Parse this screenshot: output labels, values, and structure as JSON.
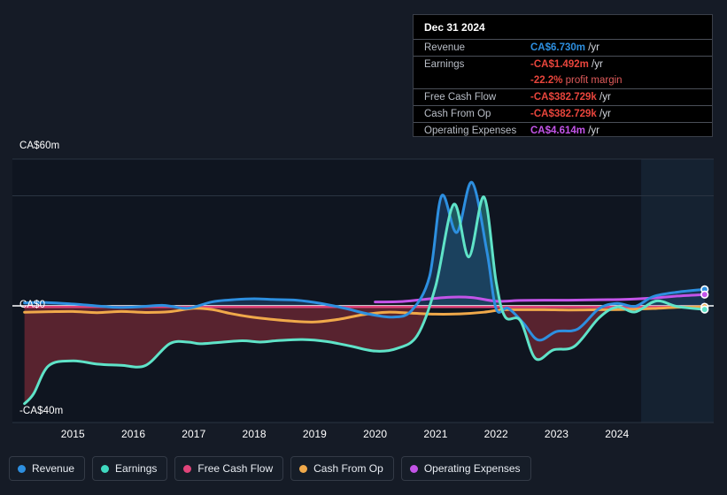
{
  "chart_data": {
    "type": "area",
    "title": "",
    "xlabel": "",
    "ylabel": "",
    "currency": "CA$",
    "xlim": [
      2014.0,
      2025.6
    ],
    "ylim": [
      -40,
      60
    ],
    "yticks": [
      60,
      0,
      -40
    ],
    "ytick_labels": [
      "CA$60m",
      "CA$0",
      "-CA$40m"
    ],
    "gridlines": [
      60,
      45
    ],
    "categories": [
      "2015",
      "2016",
      "2017",
      "2018",
      "2019",
      "2020",
      "2021",
      "2022",
      "2023",
      "2024"
    ],
    "xtick_years": [
      2015,
      2016,
      2017,
      2018,
      2019,
      2020,
      2021,
      2022,
      2023,
      2024
    ],
    "forecast_start_year": 2024.4,
    "legend_position": "bottom",
    "grid": true,
    "series": [
      {
        "name": "Revenue",
        "color": "#2d8fe0",
        "x": [
          2014.2,
          2014.5,
          2014.9,
          2015.3,
          2015.7,
          2016.1,
          2016.5,
          2016.9,
          2017.3,
          2017.7,
          2018.0,
          2018.3,
          2018.7,
          2019.1,
          2019.5,
          2019.9,
          2020.3,
          2020.6,
          2020.9,
          2021.1,
          2021.35,
          2021.6,
          2021.85,
          2022.0,
          2022.2,
          2022.45,
          2022.7,
          2023.0,
          2023.35,
          2023.7,
          2024.0,
          2024.3,
          2024.6,
          2025.0,
          2025.45
        ],
        "values": [
          1.2,
          1.4,
          0.9,
          0.2,
          -0.6,
          -0.4,
          0.2,
          -1.0,
          1.6,
          2.6,
          2.9,
          2.6,
          2.3,
          1.0,
          -1.0,
          -3.4,
          -4.6,
          -2.0,
          12.0,
          45.0,
          30.0,
          50.5,
          22.0,
          -1.2,
          -1.0,
          -7.0,
          -14.0,
          -10.5,
          -9.5,
          -1.2,
          1.0,
          -0.2,
          3.8,
          5.6,
          6.73
        ]
      },
      {
        "name": "Earnings",
        "color": "#5fe3c8",
        "x": [
          2014.2,
          2014.35,
          2014.6,
          2015.0,
          2015.4,
          2015.8,
          2016.2,
          2016.6,
          2016.9,
          2017.1,
          2017.4,
          2017.8,
          2018.1,
          2018.4,
          2018.8,
          2019.2,
          2019.6,
          2020.0,
          2020.35,
          2020.7,
          2021.0,
          2021.3,
          2021.55,
          2021.8,
          2022.0,
          2022.15,
          2022.4,
          2022.65,
          2022.95,
          2023.3,
          2023.7,
          2024.0,
          2024.3,
          2024.65,
          2025.0,
          2025.45
        ],
        "values": [
          -40.0,
          -36.0,
          -24.5,
          -22.5,
          -23.8,
          -24.3,
          -24.4,
          -15.5,
          -14.8,
          -15.5,
          -15.0,
          -14.3,
          -14.8,
          -14.2,
          -13.8,
          -14.6,
          -16.5,
          -18.5,
          -17.5,
          -12.0,
          8.0,
          41.5,
          20.0,
          44.5,
          10.0,
          -4.5,
          -6.0,
          -21.5,
          -18.0,
          -16.5,
          -5.0,
          -0.5,
          -2.5,
          2.0,
          -0.3,
          -1.49
        ]
      },
      {
        "name": "Free Cash Flow",
        "color": "#e0447a",
        "x": [
          2014.2,
          2015.0,
          2016.0,
          2017.0,
          2018.0,
          2019.0,
          2020.0,
          2021.0,
          2022.0,
          2023.0,
          2024.0,
          2025.45
        ],
        "values": [
          -0.45,
          -0.45,
          -0.45,
          -0.45,
          -0.45,
          -0.45,
          -0.45,
          -0.45,
          -0.45,
          -0.45,
          -0.45,
          -0.383
        ]
      },
      {
        "name": "Cash From Op",
        "color": "#f0a94a",
        "x": [
          2014.2,
          2014.6,
          2015.0,
          2015.4,
          2015.8,
          2016.2,
          2016.6,
          2017.0,
          2017.3,
          2017.6,
          2017.9,
          2018.2,
          2018.6,
          2019.0,
          2019.4,
          2019.8,
          2020.2,
          2020.6,
          2021.0,
          2021.4,
          2021.8,
          2022.1,
          2022.4,
          2022.8,
          2023.2,
          2023.7,
          2024.1,
          2024.6,
          2025.0,
          2025.45
        ],
        "values": [
          -2.6,
          -2.4,
          -2.3,
          -2.8,
          -2.3,
          -2.7,
          -2.4,
          -1.0,
          -1.5,
          -3.1,
          -4.4,
          -5.3,
          -6.2,
          -6.6,
          -5.5,
          -3.6,
          -2.6,
          -3.0,
          -3.4,
          -3.3,
          -2.6,
          -1.6,
          -1.6,
          -1.6,
          -1.7,
          -1.6,
          -1.5,
          -1.1,
          -0.6,
          -0.383
        ]
      },
      {
        "name": "Operating Expenses",
        "color": "#c354e8",
        "x": [
          2020.0,
          2020.4,
          2020.8,
          2021.2,
          2021.6,
          2022.0,
          2022.4,
          2022.8,
          2023.2,
          2023.7,
          2024.1,
          2024.6,
          2025.0,
          2025.45
        ],
        "values": [
          1.6,
          1.7,
          2.6,
          3.5,
          3.4,
          1.9,
          2.2,
          2.3,
          2.3,
          2.5,
          2.6,
          3.2,
          4.0,
          4.614
        ]
      }
    ]
  },
  "tooltip": {
    "name": "chart-tooltip",
    "date": "Dec 31 2024",
    "rows": [
      {
        "label": "Revenue",
        "value": "CA$6.730m",
        "unit": "/yr",
        "color": "#2d8fe0",
        "sub": null
      },
      {
        "label": "Earnings",
        "value": "-CA$1.492m",
        "unit": "/yr",
        "color": "#e8453c",
        "sub": {
          "value": "-22.2%",
          "text": "profit margin",
          "color": "#e8453c"
        }
      },
      {
        "label": "Free Cash Flow",
        "value": "-CA$382.729k",
        "unit": "/yr",
        "color": "#e8453c",
        "sub": null
      },
      {
        "label": "Cash From Op",
        "value": "-CA$382.729k",
        "unit": "/yr",
        "color": "#e8453c",
        "sub": null
      },
      {
        "label": "Operating Expenses",
        "value": "CA$4.614m",
        "unit": "/yr",
        "color": "#c354e8",
        "sub": null
      }
    ]
  },
  "legend": {
    "items": [
      {
        "label": "Revenue",
        "color": "#2d8fe0"
      },
      {
        "label": "Earnings",
        "color": "#3fd9c0"
      },
      {
        "label": "Free Cash Flow",
        "color": "#e0447a"
      },
      {
        "label": "Cash From Op",
        "color": "#f0a94a"
      },
      {
        "label": "Operating Expenses",
        "color": "#c354e8"
      }
    ]
  },
  "axis": {
    "y_labels": [
      "CA$60m",
      "CA$0",
      "-CA$40m"
    ],
    "x_labels": [
      "2015",
      "2016",
      "2017",
      "2018",
      "2019",
      "2020",
      "2021",
      "2022",
      "2023",
      "2024"
    ]
  },
  "colors": {
    "background": "#151b26",
    "plot_background": "#0f1520",
    "forecast_background": "#152231",
    "grid": "#2a3442",
    "zero_line": "#ffffff",
    "negative_fill": "#5c2430",
    "positive_fill": "#1f5f66"
  }
}
